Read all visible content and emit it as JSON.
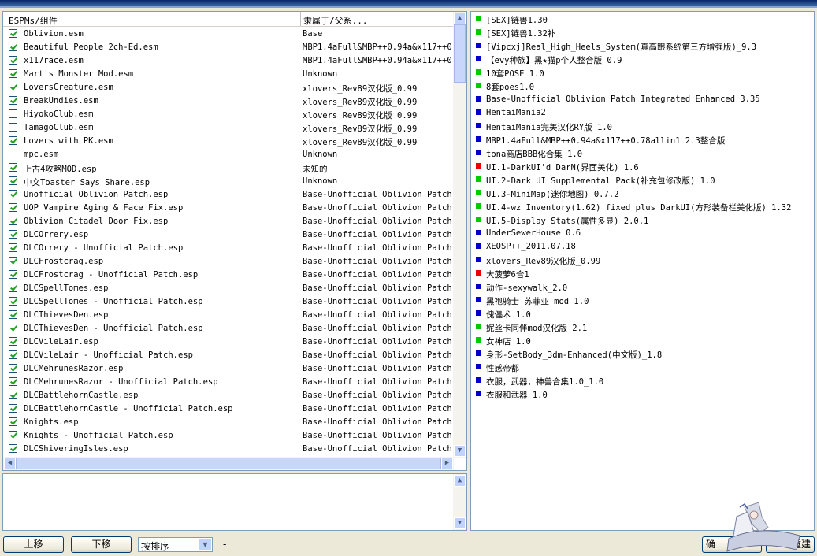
{
  "list": {
    "col_name": "ESPMs/组件",
    "col_master": "隶属于/父系...",
    "rows": [
      {
        "name": "Oblivion.esm",
        "master": "Base",
        "checked": true
      },
      {
        "name": "Beautiful People 2ch-Ed.esm",
        "master": "MBP1.4aFull&MBP++0.94a&x117++0.7",
        "checked": true
      },
      {
        "name": "x117race.esm",
        "master": "MBP1.4aFull&MBP++0.94a&x117++0.7",
        "checked": true
      },
      {
        "name": "Mart's Monster Mod.esm",
        "master": "Unknown",
        "checked": true
      },
      {
        "name": "LoversCreature.esm",
        "master": "xlovers_Rev89汉化版_0.99",
        "checked": true
      },
      {
        "name": "BreakUndies.esm",
        "master": "xlovers_Rev89汉化版_0.99",
        "checked": true
      },
      {
        "name": "HiyokoClub.esm",
        "master": "xlovers_Rev89汉化版_0.99",
        "checked": false
      },
      {
        "name": "TamagoClub.esm",
        "master": "xlovers_Rev89汉化版_0.99",
        "checked": false
      },
      {
        "name": "Lovers with PK.esm",
        "master": "xlovers_Rev89汉化版_0.99",
        "checked": true
      },
      {
        "name": "mpc.esm",
        "master": "Unknown",
        "checked": false
      },
      {
        "name": "上古4攻略MOD.esp",
        "master": "未知的",
        "checked": true
      },
      {
        "name": "中文Toaster Says Share.esp",
        "master": "Unknown",
        "checked": true
      },
      {
        "name": "Unofficial Oblivion Patch.esp",
        "master": "Base-Unofficial Oblivion Patch I",
        "checked": true
      },
      {
        "name": "UOP Vampire Aging & Face Fix.esp",
        "master": "Base-Unofficial Oblivion Patch I",
        "checked": true
      },
      {
        "name": "Oblivion Citadel Door Fix.esp",
        "master": "Base-Unofficial Oblivion Patch I",
        "checked": true
      },
      {
        "name": "DLCOrrery.esp",
        "master": "Base-Unofficial Oblivion Patch I",
        "checked": true
      },
      {
        "name": "DLCOrrery - Unofficial Patch.esp",
        "master": "Base-Unofficial Oblivion Patch I",
        "checked": true
      },
      {
        "name": "DLCFrostcrag.esp",
        "master": "Base-Unofficial Oblivion Patch I",
        "checked": true
      },
      {
        "name": "DLCFrostcrag - Unofficial Patch.esp",
        "master": "Base-Unofficial Oblivion Patch I",
        "checked": true
      },
      {
        "name": "DLCSpellTomes.esp",
        "master": "Base-Unofficial Oblivion Patch I",
        "checked": true
      },
      {
        "name": "DLCSpellTomes - Unofficial Patch.esp",
        "master": "Base-Unofficial Oblivion Patch I",
        "checked": true
      },
      {
        "name": "DLCThievesDen.esp",
        "master": "Base-Unofficial Oblivion Patch I",
        "checked": true
      },
      {
        "name": "DLCThievesDen - Unofficial Patch.esp",
        "master": "Base-Unofficial Oblivion Patch I",
        "checked": true
      },
      {
        "name": "DLCVileLair.esp",
        "master": "Base-Unofficial Oblivion Patch I",
        "checked": true
      },
      {
        "name": "DLCVileLair - Unofficial Patch.esp",
        "master": "Base-Unofficial Oblivion Patch I",
        "checked": true
      },
      {
        "name": "DLCMehrunesRazor.esp",
        "master": "Base-Unofficial Oblivion Patch I",
        "checked": true
      },
      {
        "name": "DLCMehrunesRazor - Unofficial Patch.esp",
        "master": "Base-Unofficial Oblivion Patch I",
        "checked": true
      },
      {
        "name": "DLCBattlehornCastle.esp",
        "master": "Base-Unofficial Oblivion Patch I",
        "checked": true
      },
      {
        "name": "DLCBattlehornCastle - Unofficial Patch.esp",
        "master": "Base-Unofficial Oblivion Patch I",
        "checked": true
      },
      {
        "name": "Knights.esp",
        "master": "Base-Unofficial Oblivion Patch I",
        "checked": true
      },
      {
        "name": "Knights - Unofficial Patch.esp",
        "master": "Base-Unofficial Oblivion Patch I",
        "checked": true
      },
      {
        "name": "DLCShiveringIsles.esp",
        "master": "Base-Unofficial Oblivion Patch I",
        "checked": true
      }
    ]
  },
  "groups": [
    {
      "label": "[SEX]链兽1.30",
      "color": "#00cc00"
    },
    {
      "label": "[SEX]链兽1.32补",
      "color": "#00cc00"
    },
    {
      "label": "[Vipcxj]Real_High_Heels_System(真高跟系统第三方增强版)_9.3",
      "color": "#0000cc"
    },
    {
      "label": "【evy种族】黑★猫p个人整合版_0.9",
      "color": "#0000cc"
    },
    {
      "label": "10套POSE 1.0",
      "color": "#00cc00"
    },
    {
      "label": "8套poes1.0",
      "color": "#00cc00"
    },
    {
      "label": "Base-Unofficial Oblivion Patch Integrated Enhanced 3.35",
      "color": "#0000cc"
    },
    {
      "label": "HentaiMania2",
      "color": "#0000cc"
    },
    {
      "label": "HentaiMania完美汉化RY版 1.0",
      "color": "#0000cc"
    },
    {
      "label": "MBP1.4aFull&MBP++0.94a&x117++0.78allin1  2.3整合版",
      "color": "#0000cc"
    },
    {
      "label": "tona商店BBB化合集 1.0",
      "color": "#0000cc"
    },
    {
      "label": "UI.1-DarkUI'd DarN(界面美化) 1.6",
      "color": "#ee0000"
    },
    {
      "label": "UI.2-Dark UI Supplemental Pack(补充包修改版) 1.0",
      "color": "#00cc00"
    },
    {
      "label": "UI.3-MiniMap(迷你地图) 0.7.2",
      "color": "#00cc00"
    },
    {
      "label": "UI.4-wz Inventory(1.62) fixed plus DarkUI(方形装备栏美化版) 1.32",
      "color": "#00cc00"
    },
    {
      "label": "UI.5-Display Stats(属性多显) 2.0.1",
      "color": "#00cc00"
    },
    {
      "label": "UnderSewerHouse 0.6",
      "color": "#0000cc"
    },
    {
      "label": "XEOSP++_2011.07.18",
      "color": "#0000cc"
    },
    {
      "label": "xlovers_Rev89汉化版_0.99",
      "color": "#0000cc"
    },
    {
      "label": "大菠萝6合1",
      "color": "#ee0000"
    },
    {
      "label": "动作-sexywalk_2.0",
      "color": "#0000cc"
    },
    {
      "label": "黑袍骑士_苏菲亚_mod_1.0",
      "color": "#0000cc"
    },
    {
      "label": "傀儡术 1.0",
      "color": "#0000cc"
    },
    {
      "label": "妮丝卡同伴mod汉化版 2.1",
      "color": "#00cc00"
    },
    {
      "label": "女神店 1.0",
      "color": "#00cc00"
    },
    {
      "label": "身形-SetBody_3dm-Enhanced(中文版)_1.8",
      "color": "#0000cc"
    },
    {
      "label": "性感帝都",
      "color": "#0000cc"
    },
    {
      "label": "衣服，武器，神兽合集1.0_1.0",
      "color": "#0000cc"
    },
    {
      "label": "衣服和武器 1.0",
      "color": "#0000cc"
    }
  ],
  "toolbar": {
    "move_up": "上移",
    "move_down": "下移",
    "sort_value": "按排序",
    "dash": "-",
    "right_btn1": "确",
    "right_btn2": "重建"
  }
}
